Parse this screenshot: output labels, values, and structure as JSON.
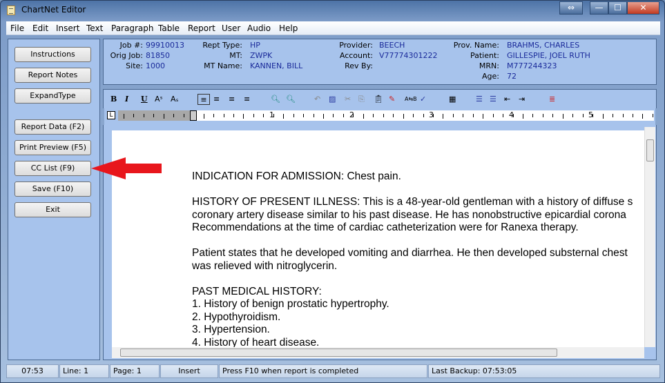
{
  "window": {
    "title": "ChartNet Editor",
    "controls": [
      "⇔",
      "—",
      "☐",
      "✕"
    ]
  },
  "menu": [
    {
      "label": "File"
    },
    {
      "label": "Edit"
    },
    {
      "label": "Insert"
    },
    {
      "label": "Text"
    },
    {
      "label": "Paragraph"
    },
    {
      "label": "Table"
    },
    {
      "label": "Report"
    },
    {
      "label": "User"
    },
    {
      "label": "Audio"
    },
    {
      "label": "Help"
    }
  ],
  "sidebar": {
    "buttons": [
      {
        "label": "Instructions"
      },
      {
        "label": "Report Notes"
      },
      {
        "label": "ExpandType"
      },
      {
        "label": "Report Data (F2)"
      },
      {
        "label": "Print Preview (F5)"
      },
      {
        "label": "CC List (F9)"
      },
      {
        "label": "Save (F10)"
      },
      {
        "label": "Exit"
      }
    ]
  },
  "header": {
    "job_label": "Job #:",
    "job": "99910013",
    "orig_label": "Orig Job:",
    "orig": "81850",
    "site_label": "Site:",
    "site": "1000",
    "rept_label": "Rept Type:",
    "rept": "HP",
    "mt_label": "MT:",
    "mt": "ZWPK",
    "mtname_label": "MT Name:",
    "mtname": "KANNEN, BILL",
    "provider_label": "Provider:",
    "provider": "BEECH",
    "account_label": "Account:",
    "account": "V77774301222",
    "revby_label": "Rev By:",
    "provname_label": "Prov. Name:",
    "provname": "BRAHMS, CHARLES",
    "patient_label": "Patient:",
    "patient": "GILLESPIE, JOEL RUTH",
    "mrn_label": "MRN:",
    "mrn": "M777244323",
    "age_label": "Age:",
    "age": "72"
  },
  "toolbar": {
    "bold": "B",
    "italic": "I",
    "underline": "U",
    "superscript": "Aˢ",
    "subscript": "Aₛ"
  },
  "ruler": {
    "numbers": [
      "1",
      "2",
      "3",
      "4",
      "5"
    ]
  },
  "document": {
    "lines": [
      "INDICATION FOR ADMISSION:  Chest pain.",
      "",
      "HISTORY OF PRESENT ILLNESS:  This is a 48-year-old gentleman with a history of diffuse s",
      "coronary artery disease similar to his  past disease.  He has nonobstructive epicardial corona",
      "Recommendations at the time of cardiac catheterization were for Ranexa therapy.",
      "",
      "Patient states that he developed vomiting and diarrhea.  He then developed substernal chest",
      "was relieved with nitroglycerin.",
      "",
      "PAST MEDICAL HISTORY:",
      "1.  History of benign prostatic hypertrophy.",
      "2.  Hypothyroidism.",
      "3.  Hypertension.",
      "4.  History of  heart disease."
    ]
  },
  "status": {
    "time": "07:53",
    "line": "Line:  1",
    "page": "Page:  1",
    "mode": "Insert",
    "message": "Press F10 when report is completed",
    "backup": "Last Backup: 07:53:05"
  },
  "colors": {
    "panel": "#a7c3ec",
    "value_text": "#1a2a9a",
    "arrow": "#e8161c"
  }
}
